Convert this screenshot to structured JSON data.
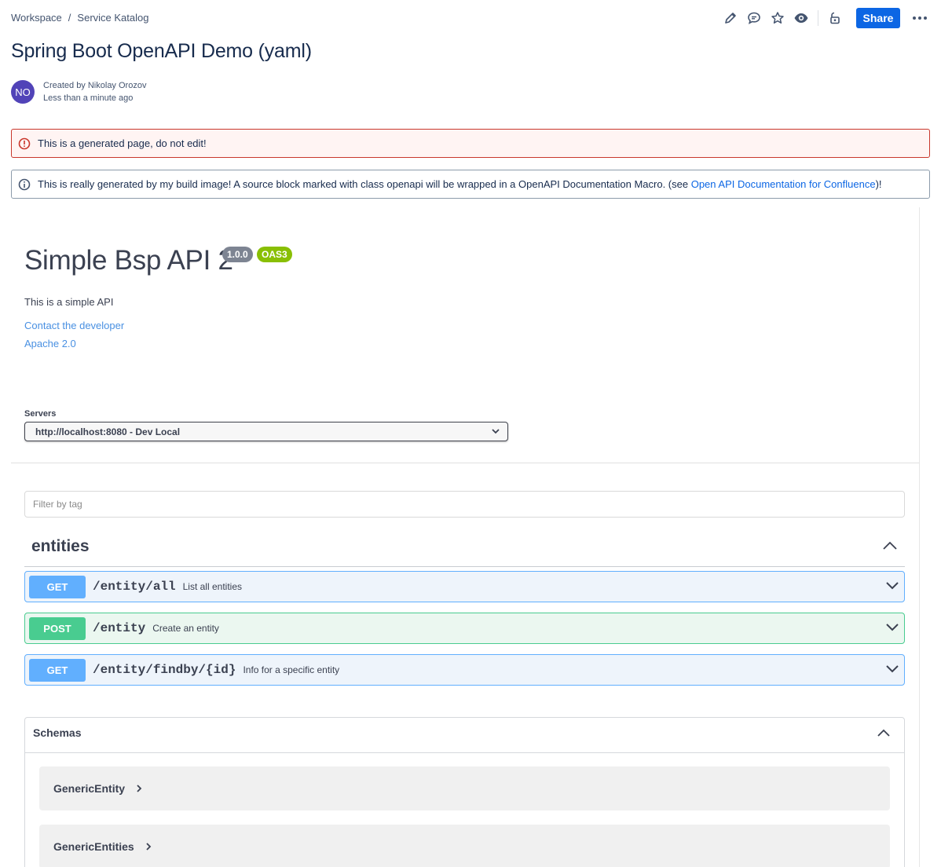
{
  "breadcrumb": {
    "items": [
      "Workspace",
      "Service Katalog"
    ],
    "separator": "/"
  },
  "toolbar": {
    "icons": [
      "edit-icon",
      "comment-icon",
      "star-icon",
      "watch-icon",
      "restrictions-icon",
      "more-icon"
    ],
    "share_label": "Share",
    "accent": "#0c66e4"
  },
  "page": {
    "title": "Spring Boot OpenAPI Demo (yaml)",
    "author_initials": "NO",
    "created_by": "Created by Nikolay Orozov",
    "timestamp": "Less than a minute ago"
  },
  "panels": {
    "error_text": "This is a generated page, do not edit!",
    "info_text": "This is really generated by my build image! A source block marked with class openapi will be wrapped in a OpenAPI Documentation Macro. (see ",
    "info_link": "Open API Documentation for Confluence",
    "info_suffix": ")!"
  },
  "api": {
    "title": "Simple Bsp API 2",
    "version": "1.0.0",
    "oas_badge": "OAS3",
    "description": "This is a simple API",
    "links": [
      "Contact the developer",
      "Apache 2.0"
    ]
  },
  "servers": {
    "label": "Servers",
    "selected": "http://localhost:8080 - Dev Local"
  },
  "filter": {
    "placeholder": "Filter by tag"
  },
  "tag": {
    "name": "entities"
  },
  "operations": [
    {
      "method": "GET",
      "path": "/entity/all",
      "summary": "List all entities"
    },
    {
      "method": "POST",
      "path": "/entity",
      "summary": "Create an entity"
    },
    {
      "method": "GET",
      "path": "/entity/findby/{id}",
      "summary": "Info for a specific entity"
    }
  ],
  "schemas": {
    "title": "Schemas",
    "models": [
      "GenericEntity",
      "GenericEntities"
    ]
  },
  "colors": {
    "get": "#61affe",
    "post": "#49cc90",
    "error": "#c9372c",
    "avatar": "#5143b8"
  }
}
